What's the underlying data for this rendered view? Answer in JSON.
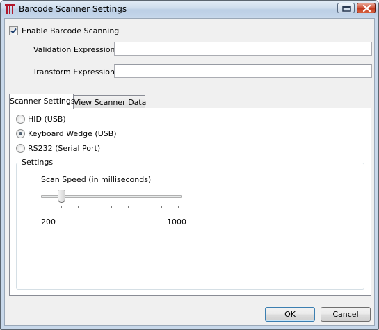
{
  "window": {
    "title": "Barcode Scanner Settings"
  },
  "form": {
    "enable_label": "Enable Barcode Scanning",
    "enable_checked": true,
    "validation_label": "Validation Expression",
    "validation_value": "",
    "transform_label": "Transform Expression",
    "transform_value": ""
  },
  "tabs": [
    {
      "label": "Scanner Settings",
      "active": true
    },
    {
      "label": "View Scanner Data",
      "active": false
    }
  ],
  "scanner": {
    "options": [
      {
        "label": "HID (USB)",
        "selected": false
      },
      {
        "label": "Keyboard Wedge (USB)",
        "selected": true
      },
      {
        "label": "RS232 (Serial Port)",
        "selected": false
      }
    ],
    "group_title": "Settings",
    "speed_label": "Scan Speed (in milliseconds)",
    "slider": {
      "min": 200,
      "max": 1000,
      "value": 300,
      "tick_count": 9
    },
    "min_label": "200",
    "max_label": "1000"
  },
  "buttons": {
    "ok": "OK",
    "cancel": "Cancel"
  },
  "colors": {
    "titlebar": "#c4d6ea",
    "close_button": "#c13a1f",
    "default_button_border": "#3c7fb1"
  }
}
